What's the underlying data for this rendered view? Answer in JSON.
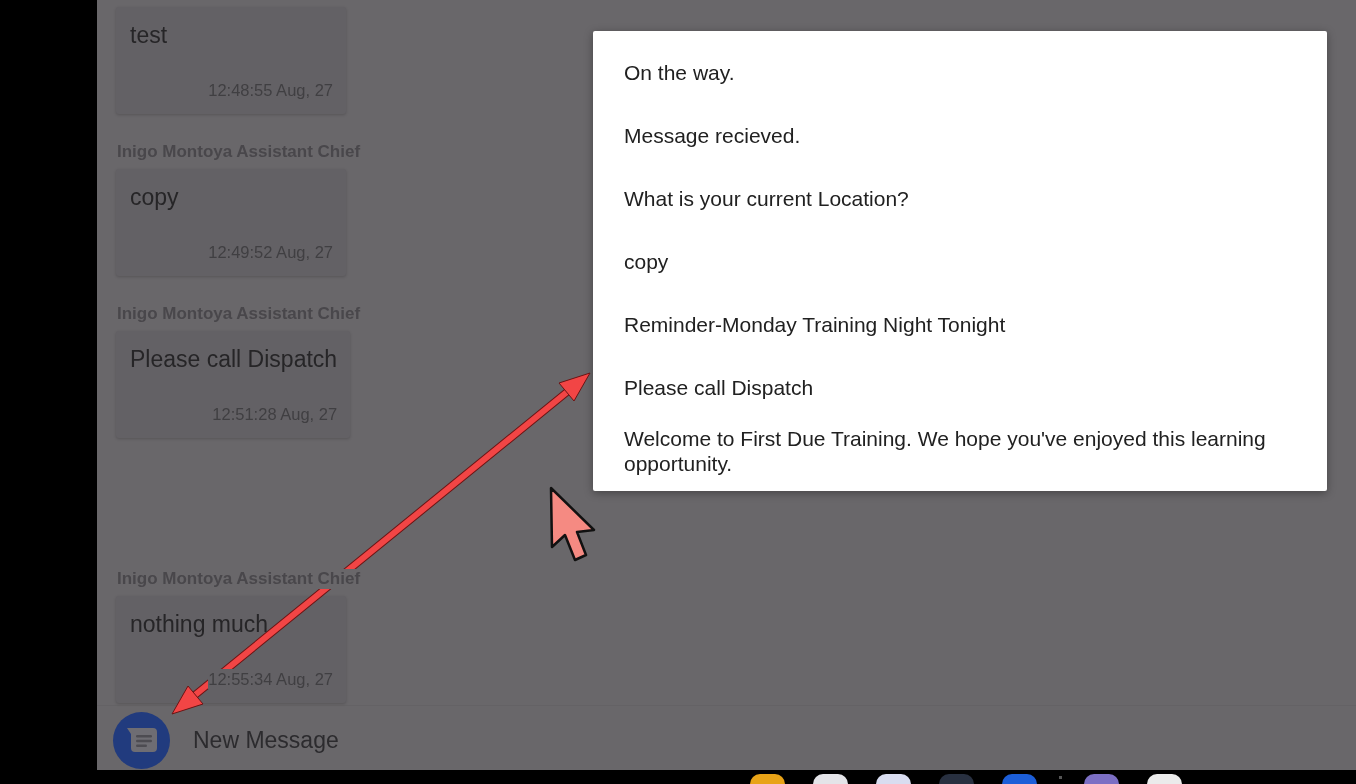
{
  "chat": {
    "messages": [
      {
        "text": "test",
        "time": "12:48:55 Aug, 27"
      },
      {
        "sender": "Inigo Montoya Assistant Chief",
        "text": "copy",
        "time": "12:49:52 Aug, 27"
      },
      {
        "sender": "Inigo Montoya Assistant Chief",
        "text": "Please call Dispatch",
        "time": "12:51:28 Aug, 27"
      },
      {
        "sender": "Inigo Montoya Assistant Chief",
        "text": "nothing much",
        "time": "12:55:34 Aug, 27"
      }
    ]
  },
  "compose": {
    "label": "New Message"
  },
  "quick_replies": {
    "items": [
      "On the way.",
      "Message recieved.",
      "What is your current Location?",
      "copy",
      "Reminder-Monday Training Night Tonight",
      "Please call Dispatch",
      "Welcome to First Due Training. We hope you've enjoyed this learning opportunity."
    ]
  },
  "taskbar": {
    "items": [
      {
        "kind": "app",
        "color": "#e8a317"
      },
      {
        "kind": "app",
        "color": "#e4e4e8"
      },
      {
        "kind": "app",
        "color": "#d9ddf0"
      },
      {
        "kind": "app",
        "color": "#283040"
      },
      {
        "kind": "app",
        "color": "#1c5ed8"
      },
      {
        "kind": "divider"
      },
      {
        "kind": "app",
        "color": "#7c6fc4"
      },
      {
        "kind": "app",
        "color": "#ebebeb"
      }
    ]
  }
}
